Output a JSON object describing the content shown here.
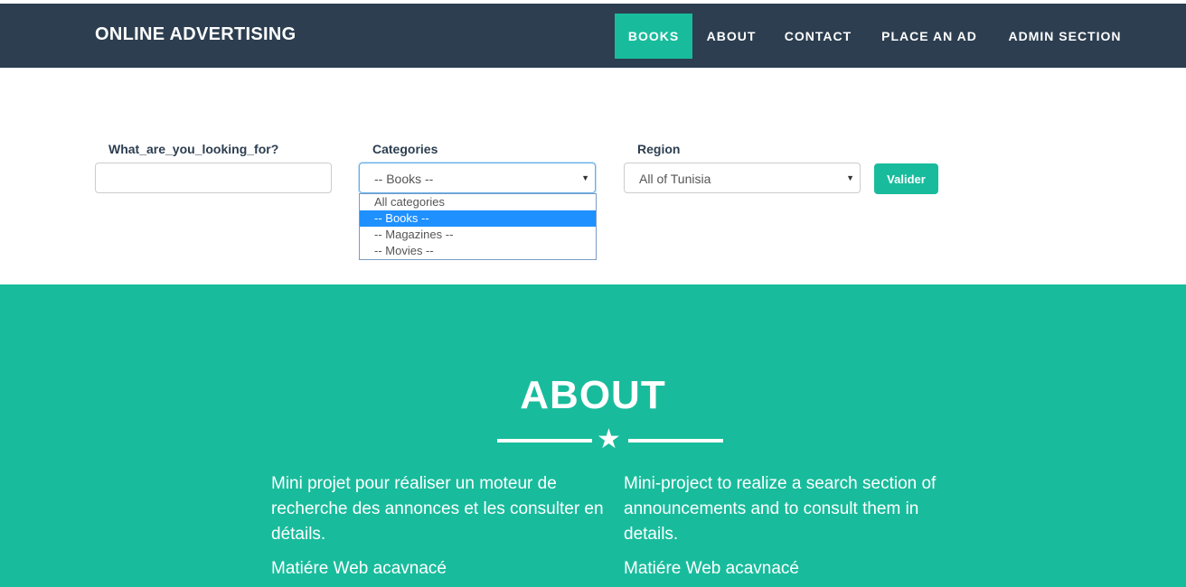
{
  "navbar": {
    "brand": "ONLINE ADVERTISING",
    "items": [
      {
        "label": "BOOKS",
        "active": true
      },
      {
        "label": "ABOUT",
        "active": false
      },
      {
        "label": "CONTACT",
        "active": false
      },
      {
        "label": "PLACE AN AD",
        "active": false
      },
      {
        "label": "ADMIN SECTION",
        "active": false
      }
    ]
  },
  "search": {
    "keyword_label": "What_are_you_looking_for?",
    "keyword_value": "",
    "categories_label": "Categories",
    "categories_selected": "-- Books --",
    "categories_options": [
      "All categories",
      "-- Books --",
      "-- Magazines --",
      "-- Movies --"
    ],
    "region_label": "Region",
    "region_selected": "All of Tunisia",
    "submit_label": "Valider"
  },
  "about": {
    "title": "ABOUT",
    "left_paragraph": "Mini projet pour réaliser un moteur de recherche des annonces et les consulter en détails.",
    "left_sub": "Matiére Web acavnacé",
    "right_paragraph": "Mini-project to realize a search section of announcements and to consult them in details.",
    "right_sub": "Matiére Web acavnacé"
  },
  "colors": {
    "navbar_bg": "#2c3e50",
    "accent": "#18bc9c",
    "dropdown_highlight": "#1e90ff"
  },
  "icons": {
    "divider": "star-icon",
    "select_arrow": "caret-down-icon"
  }
}
